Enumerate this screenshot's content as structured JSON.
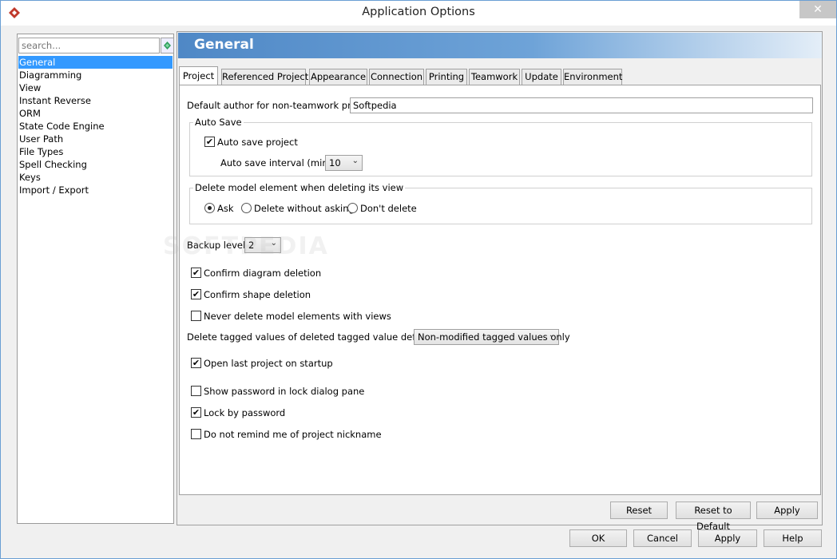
{
  "window": {
    "title": "Application Options",
    "close_label": "✕"
  },
  "sidebar": {
    "search_placeholder": "search...",
    "items": [
      "General",
      "Diagramming",
      "View",
      "Instant Reverse",
      "ORM",
      "State Code Engine",
      "User Path",
      "File Types",
      "Spell Checking",
      "Keys",
      "Import / Export"
    ],
    "selected_index": 0
  },
  "header": {
    "title": "General"
  },
  "tabs": [
    "Project",
    "Referenced Project",
    "Appearance",
    "Connection",
    "Printing",
    "Teamwork",
    "Update",
    "Environment"
  ],
  "project": {
    "default_author_label": "Default author for non-teamwork project:",
    "default_author_value": "Softpedia",
    "auto_save": {
      "group_title": "Auto Save",
      "auto_save_label": "Auto save project",
      "auto_save_checked": true,
      "interval_label": "Auto save interval (mins) :",
      "interval_value": "10"
    },
    "delete_model": {
      "group_title": "Delete model element when deleting its view",
      "options": [
        "Ask",
        "Delete without asking",
        "Don't delete"
      ],
      "selected": "Ask"
    },
    "backup_level_label": "Backup level :",
    "backup_level_value": "2",
    "confirm_diagram_label": "Confirm diagram deletion",
    "confirm_diagram_checked": true,
    "confirm_shape_label": "Confirm shape deletion",
    "confirm_shape_checked": true,
    "never_delete_label": "Never delete model elements with views",
    "never_delete_checked": false,
    "tagged_values_label": "Delete tagged values of deleted tagged value definitions :",
    "tagged_values_value": "Non-modified tagged values only",
    "open_last_label": "Open last project on startup",
    "open_last_checked": true,
    "show_password_label": "Show password in lock dialog pane",
    "show_password_checked": false,
    "lock_password_label": "Lock by password",
    "lock_password_checked": true,
    "no_remind_label": "Do not remind me of project nickname",
    "no_remind_checked": false
  },
  "panel_buttons": {
    "reset": "Reset",
    "reset_default": "Reset to Default",
    "apply": "Apply"
  },
  "dialog_buttons": {
    "ok": "OK",
    "cancel": "Cancel",
    "apply": "Apply",
    "help": "Help"
  },
  "watermark": "SOFTPEDIA"
}
